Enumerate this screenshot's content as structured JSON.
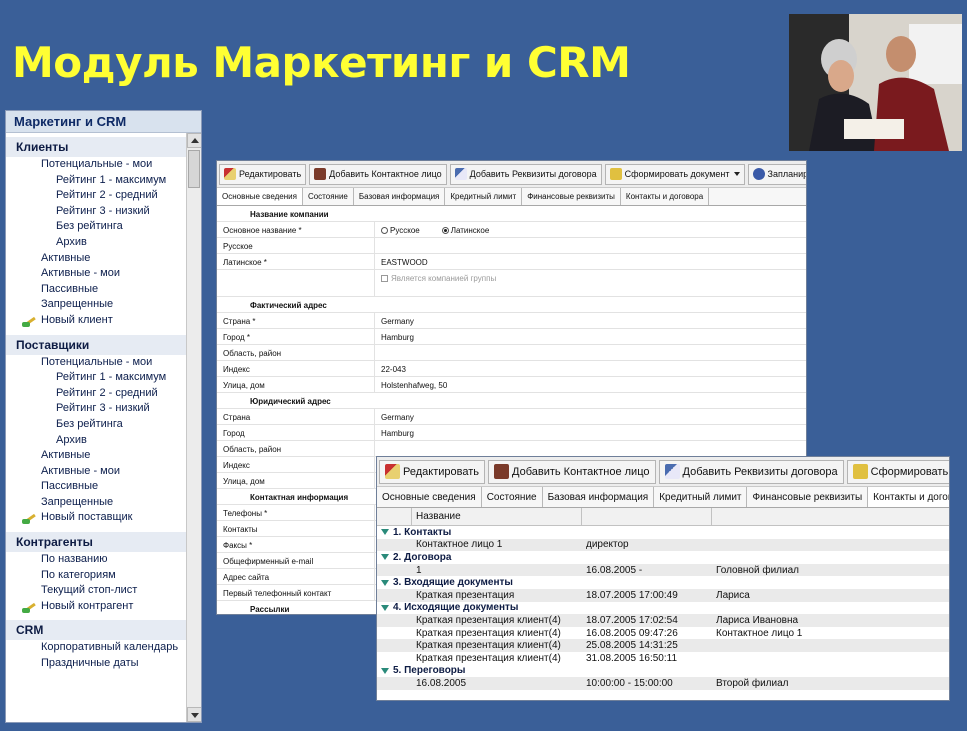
{
  "slide_title": "Модуль Маркетинг и CRM",
  "nav": {
    "header": "Маркетинг и CRM",
    "sections": [
      {
        "title": "Клиенты",
        "items": [
          {
            "label": "Потенциальные - мои",
            "level": 1
          },
          {
            "label": "Рейтинг 1 - максимум",
            "level": 2
          },
          {
            "label": "Рейтинг 2 - средний",
            "level": 2
          },
          {
            "label": "Рейтинг 3 - низкий",
            "level": 2
          },
          {
            "label": "Без рейтинга",
            "level": 2
          },
          {
            "label": "Архив",
            "level": 2
          },
          {
            "label": "Активные",
            "level": 1
          },
          {
            "label": "Активные - мои",
            "level": 1
          },
          {
            "label": "Пассивные",
            "level": 1
          },
          {
            "label": "Запрещенные",
            "level": 1
          },
          {
            "label": "Новый клиент",
            "level": 0,
            "icon": "pencil-icon"
          }
        ]
      },
      {
        "title": "Поставщики",
        "items": [
          {
            "label": "Потенциальные - мои",
            "level": 1
          },
          {
            "label": "Рейтинг 1 - максимум",
            "level": 2
          },
          {
            "label": "Рейтинг 2 - средний",
            "level": 2
          },
          {
            "label": "Рейтинг 3 - низкий",
            "level": 2
          },
          {
            "label": "Без рейтинга",
            "level": 2
          },
          {
            "label": "Архив",
            "level": 2
          },
          {
            "label": "Активные",
            "level": 1
          },
          {
            "label": "Активные - мои",
            "level": 1
          },
          {
            "label": "Пассивные",
            "level": 1
          },
          {
            "label": "Запрещенные",
            "level": 1
          },
          {
            "label": "Новый поставщик",
            "level": 0,
            "icon": "pencil-icon"
          }
        ]
      },
      {
        "title": "Контрагенты",
        "items": [
          {
            "label": "По названию",
            "level": 1
          },
          {
            "label": "По категориям",
            "level": 1
          },
          {
            "label": "Текущий стоп-лист",
            "level": 1
          },
          {
            "label": "Новый контрагент",
            "level": 0,
            "icon": "pencil-icon"
          }
        ]
      },
      {
        "title": "CRM",
        "items": [
          {
            "label": "Корпоративный календарь",
            "level": 1
          },
          {
            "label": "Праздничные даты",
            "level": 1
          }
        ]
      }
    ]
  },
  "win1": {
    "toolbar": [
      "Редактировать",
      "Добавить Контактное лицо",
      "Добавить Реквизиты договора",
      "Сформировать документ",
      "Запланировать переговоры"
    ],
    "tabs": [
      "Основные сведения",
      "Состояние",
      "Базовая информация",
      "Кредитный лимит",
      "Финансовые реквизиты",
      "Контакты и договора"
    ],
    "company_group": "Название компании",
    "name_label": "Основное название *",
    "radio_ru": "Русское",
    "radio_lat": "Латинское",
    "russian_label": "Русское",
    "latin_label": "Латинское *",
    "latin_value": "EASTWOOD",
    "group_checkbox": "Является компанией группы",
    "fact_group": "Фактический адрес",
    "fact": [
      {
        "label": "Страна *",
        "value": "Germany"
      },
      {
        "label": "Город *",
        "value": "Hamburg"
      },
      {
        "label": "Область, район",
        "value": ""
      },
      {
        "label": "Индекс",
        "value": "22-043"
      },
      {
        "label": "Улица, дом",
        "value": "Holstenhafweg, 50"
      }
    ],
    "legal_group": "Юридический адрес",
    "legal": [
      {
        "label": "Страна",
        "value": "Germany"
      },
      {
        "label": "Город",
        "value": "Hamburg"
      },
      {
        "label": "Область, район",
        "value": ""
      },
      {
        "label": "Индекс",
        "value": ""
      },
      {
        "label": "Улица, дом",
        "value": ""
      }
    ],
    "contact_group": "Контактная информация",
    "contacts": [
      "Телефоны *",
      "Контакты",
      "Факсы *",
      "Общефирменный e-mail",
      "Адрес сайта",
      "Первый телефонный контакт"
    ],
    "mail_group": "Рассылки"
  },
  "win2": {
    "toolbar": [
      "Редактировать",
      "Добавить Контактное лицо",
      "Добавить Реквизиты договора",
      "Сформировать документ"
    ],
    "tabs": [
      "Основные сведения",
      "Состояние",
      "Базовая информация",
      "Кредитный лимит",
      "Финансовые реквизиты",
      "Контакты и договора"
    ],
    "column_name": "Название",
    "groups": [
      {
        "title": "1. Контакты",
        "rows": [
          [
            "Контактное лицо 1",
            "директор",
            ""
          ]
        ]
      },
      {
        "title": "2. Договора",
        "rows": [
          [
            "1",
            "16.08.2005 -",
            "Головной филиал"
          ]
        ]
      },
      {
        "title": "3. Входящие документы",
        "rows": [
          [
            "Краткая презентация",
            "18.07.2005 17:00:49",
            "Лариса"
          ]
        ]
      },
      {
        "title": "4. Исходящие документы",
        "rows": [
          [
            "Краткая презентация клиент(4)",
            "18.07.2005 17:02:54",
            "Лариса Ивановна"
          ],
          [
            "Краткая презентация клиент(4)",
            "16.08.2005 09:47:26",
            "Контактное лицо 1"
          ],
          [
            "Краткая презентация клиент(4)",
            "25.08.2005 14:31:25",
            ""
          ],
          [
            "Краткая презентация клиент(4)",
            "31.08.2005 16:50:11",
            ""
          ]
        ]
      },
      {
        "title": "5. Переговоры",
        "rows": [
          [
            "16.08.2005",
            "10:00:00 - 15:00:00",
            "Второй филиал"
          ]
        ]
      }
    ]
  }
}
